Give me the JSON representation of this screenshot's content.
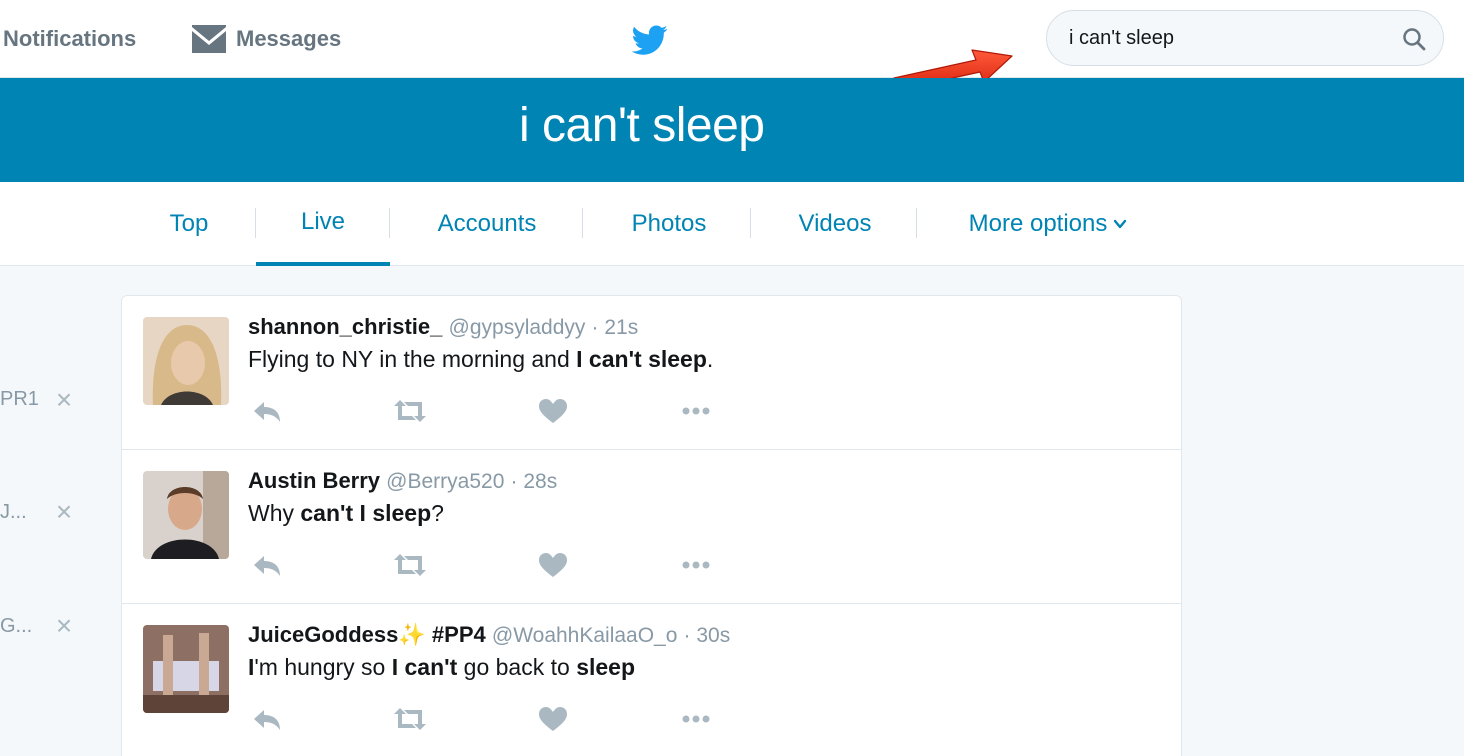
{
  "nav": {
    "notifications_label": "Notifications",
    "messages_label": "Messages",
    "logo_icon": "twitter-bird-icon"
  },
  "search": {
    "value": "i can't sleep",
    "icon": "search-icon"
  },
  "banner": {
    "title": "i can't sleep",
    "color": "#0084b4"
  },
  "tabs": [
    {
      "label": "Top",
      "active": false
    },
    {
      "label": "Live",
      "active": true
    },
    {
      "label": "Accounts",
      "active": false
    },
    {
      "label": "Photos",
      "active": false
    },
    {
      "label": "Videos",
      "active": false
    },
    {
      "label": "More options",
      "active": false
    }
  ],
  "sidebar": {
    "items": [
      {
        "label": "PR1"
      },
      {
        "label": "J..."
      },
      {
        "label": "G..."
      }
    ]
  },
  "tweets": [
    {
      "fullname": "shannon_christie_",
      "emoji": "",
      "hashtag": "",
      "handle": "@gypsyladdyy",
      "time": "· 21s",
      "text_parts": [
        {
          "t": "Flying to NY in the morning and ",
          "bold": false
        },
        {
          "t": "I can't sleep",
          "bold": true
        },
        {
          "t": ".",
          "bold": false
        }
      ]
    },
    {
      "fullname": "Austin Berry",
      "emoji": "",
      "hashtag": "",
      "handle": "@Berrya520",
      "time": "· 28s",
      "text_parts": [
        {
          "t": "Why ",
          "bold": false
        },
        {
          "t": "can't I sleep",
          "bold": true
        },
        {
          "t": "?",
          "bold": false
        }
      ]
    },
    {
      "fullname": "JuiceGoddess",
      "emoji": "✨",
      "hashtag": "#PP4",
      "handle": "@WoahhKailaaO_o",
      "time": "· 30s",
      "text_parts": [
        {
          "t": "I",
          "bold": true
        },
        {
          "t": "'m hungry so ",
          "bold": false
        },
        {
          "t": "I can't",
          "bold": true
        },
        {
          "t": " go back to ",
          "bold": false
        },
        {
          "t": "sleep",
          "bold": true
        }
      ]
    }
  ],
  "colors": {
    "accent": "#0084b4",
    "muted": "#8899a6",
    "icon_gray": "#aab8c2",
    "annotation_arrow": "#e8321c"
  }
}
